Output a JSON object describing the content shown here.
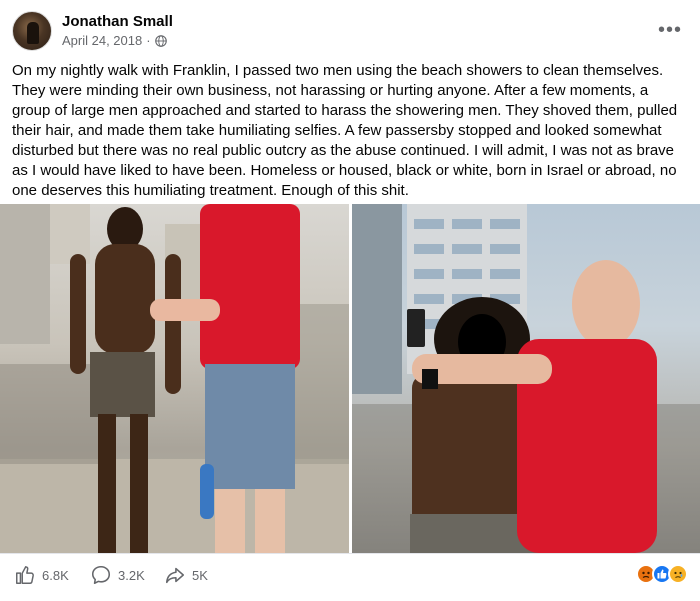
{
  "post": {
    "author": "Jonathan Small",
    "date": "April 24, 2018",
    "separator": "·",
    "text": "On my nightly walk with Franklin, I passed two men using the beach showers to clean themselves. They were minding their own business, not harassing or hurting anyone. After a few moments, a group of large men approached and started to harass the showering men. They shoved them, pulled their hair, and made them take humiliating selfies. A few passersby stopped and looked somewhat disturbed but there was no real public outcry as the abuse continued. I will admit, I was not as brave as I would have liked to have been. Homeless or housed, black or white, born in Israel or abroad, no one deserves this humiliating treatment. Enough of this shit."
  },
  "stats": {
    "likes": "6.8K",
    "comments": "3.2K",
    "shares": "5K"
  },
  "icons": {
    "avatar": "avatar-photo",
    "privacy": "globe-icon",
    "more": "more-options-icon",
    "like": "thumbs-up-icon",
    "comment": "comment-bubble-icon",
    "share": "share-arrow-icon",
    "reactions": [
      "angry-reaction-icon",
      "like-reaction-icon",
      "sad-reaction-icon"
    ]
  },
  "colors": {
    "accent": "#1877f2",
    "muted": "#65676b",
    "angry": "#e9710f",
    "sad": "#f7b125"
  }
}
